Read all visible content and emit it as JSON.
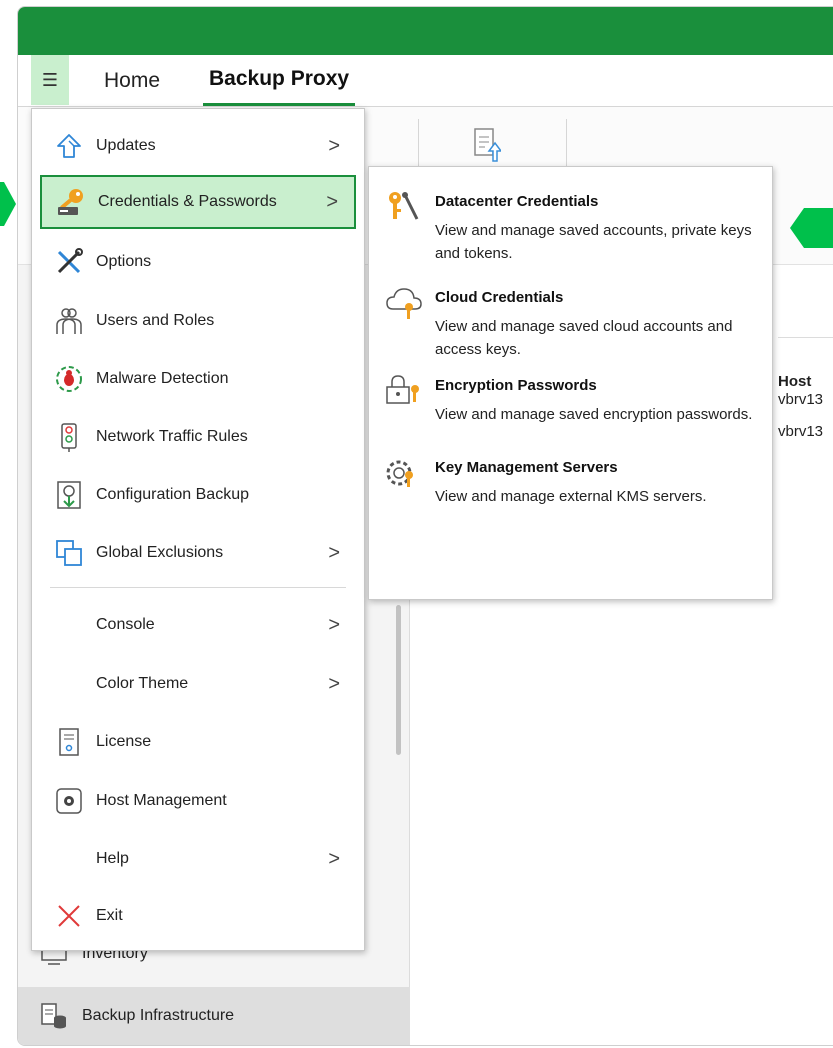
{
  "tabs": {
    "home": "Home",
    "active": "Backup Proxy"
  },
  "menu": {
    "items": [
      {
        "label": "Updates",
        "icon": "updates-arrow-icon",
        "has_submenu": true
      },
      {
        "label": "Credentials & Passwords",
        "icon": "key-icon",
        "has_submenu": true,
        "active": true
      },
      {
        "label": "Options",
        "icon": "tools-icon",
        "has_submenu": false
      },
      {
        "label": "Users and Roles",
        "icon": "users-icon",
        "has_submenu": false
      },
      {
        "label": "Malware Detection",
        "icon": "bug-icon",
        "has_submenu": false
      },
      {
        "label": "Network Traffic Rules",
        "icon": "traffic-light-icon",
        "has_submenu": false
      },
      {
        "label": "Configuration Backup",
        "icon": "config-backup-icon",
        "has_submenu": false
      },
      {
        "label": "Global Exclusions",
        "icon": "exclusions-icon",
        "has_submenu": true
      },
      {
        "label": "Console",
        "icon": "",
        "has_submenu": true
      },
      {
        "label": "Color Theme",
        "icon": "",
        "has_submenu": true
      },
      {
        "label": "License",
        "icon": "license-icon",
        "has_submenu": false
      },
      {
        "label": "Host Management",
        "icon": "host-management-icon",
        "has_submenu": false
      },
      {
        "label": "Help",
        "icon": "",
        "has_submenu": true
      },
      {
        "label": "Exit",
        "icon": "exit-icon",
        "has_submenu": false
      }
    ],
    "chevron": ">"
  },
  "submenu": {
    "items": [
      {
        "title": "Datacenter Credentials",
        "desc": "View and manage saved accounts, private keys and tokens.",
        "icon": "datacenter-key-icon"
      },
      {
        "title": "Cloud Credentials",
        "desc": "View and manage saved cloud accounts and access keys.",
        "icon": "cloud-key-icon"
      },
      {
        "title": "Encryption Passwords",
        "desc": "View and manage saved encryption passwords.",
        "icon": "encryption-lock-icon"
      },
      {
        "title": "Key Management Servers",
        "desc": "View and manage external KMS servers.",
        "icon": "kms-gear-icon"
      }
    ]
  },
  "nav": {
    "inventory": "Inventory",
    "backup_infrastructure": "Backup Infrastructure"
  },
  "content": {
    "host_header": "Host",
    "rows": [
      "vbrv13",
      "vbrv13"
    ]
  },
  "colors": {
    "accent": "#1a8f3c",
    "highlight": "#c9efce",
    "arrow": "#00c04b"
  }
}
